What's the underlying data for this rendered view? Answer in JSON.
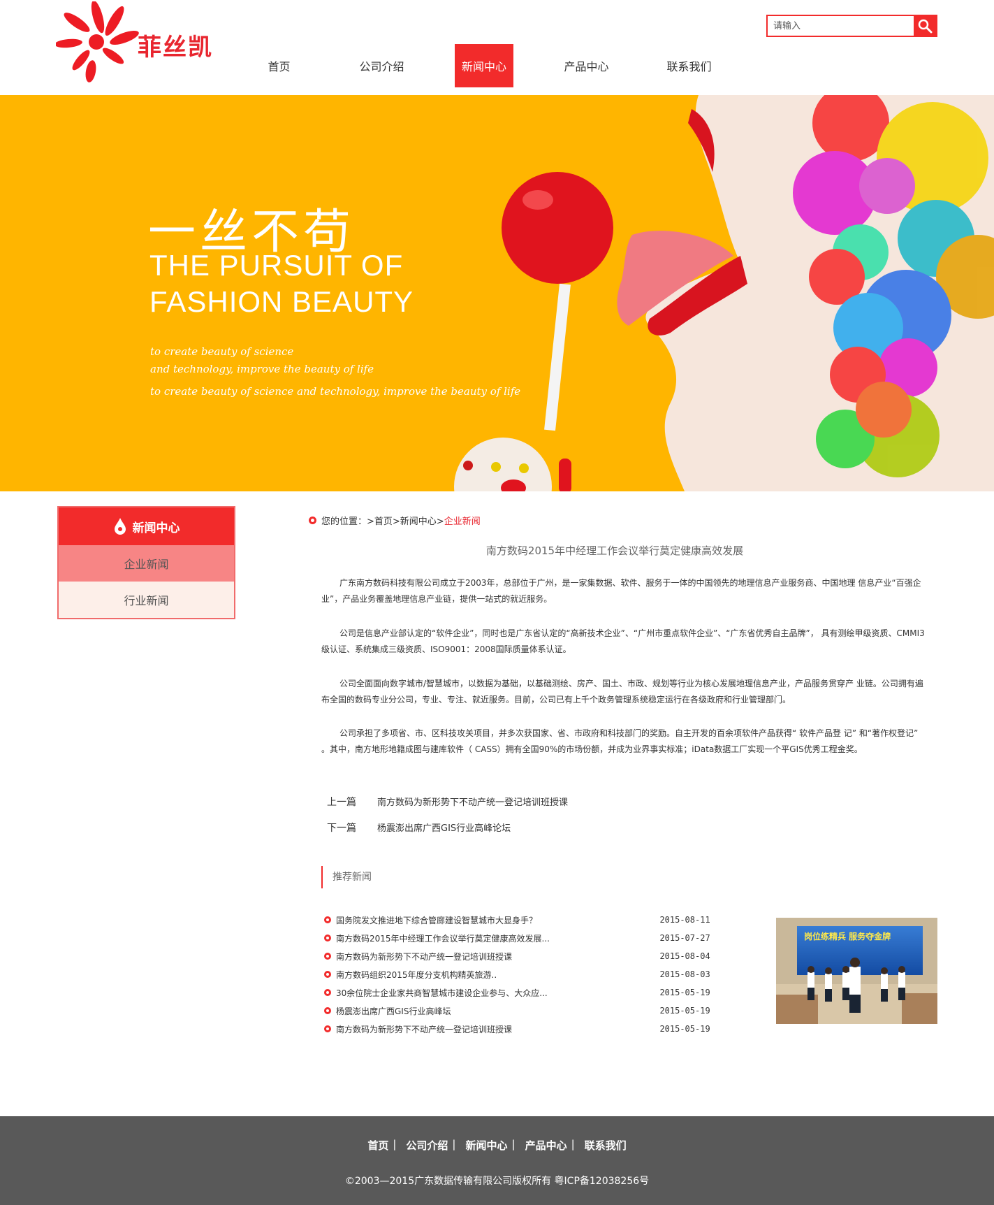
{
  "brand": {
    "logo_text": "菲丝凯",
    "accent": "#f22b2b"
  },
  "search": {
    "placeholder": "请输入"
  },
  "nav": [
    {
      "label": "首页"
    },
    {
      "label": "公司介绍"
    },
    {
      "label": "新闻中心",
      "active": true
    },
    {
      "label": "产品中心"
    },
    {
      "label": "联系我们"
    }
  ],
  "banner": {
    "headline_cn": "一丝不苟",
    "headline_en_1": "THE PURSUIT OF",
    "headline_en_2": "FASHION BEAUTY",
    "sub_1": "to create beauty of science",
    "sub_2": "and technology, improve the beauty of life",
    "sub_3": "to create beauty of science and technology, improve the beauty of life",
    "bg_color": "#ffb500"
  },
  "sidebar": {
    "title": "新闻中心",
    "items": [
      {
        "label": "企业新闻",
        "active": true
      },
      {
        "label": "行业新闻"
      }
    ]
  },
  "breadcrumb": {
    "prefix": "您的位置：",
    "path": ">首页>新闻中心>",
    "current": "企业新闻"
  },
  "article": {
    "title": "南方数码2015年中经理工作会议举行莫定健康高效发展",
    "paragraphs": [
      "广东南方数码科技有限公司成立于2003年，总部位于广州，是一家集数据、软件、服务于一体的中国领先的地理信息产业服务商、中国地理 信息产业“百强企业”，产品业务覆盖地理信息产业链，提供一站式的就近服务。",
      "公司是信息产业部认定的“软件企业”，同时也是广东省认定的“高新技术企业”、“广州市重点软件企业”、“广东省优秀自主品牌”， 具有测绘甲级资质、CMMI3级认证、系统集成三级资质、ISO9001：2008国际质量体系认证。",
      "公司全面面向数字城市/智慧城市，以数据为基础，以基础测绘、房产、国土、市政、规划等行业为核心发展地理信息产业，产品服务贯穿产 业链。公司拥有遍布全国的数码专业分公司，专业、专注、就近服务。目前，公司已有上千个政务管理系统稳定运行在各级政府和行业管理部门。",
      "公司承担了多项省、市、区科技攻关项目，并多次获国家、省、市政府和科技部门的奖励。自主开发的百余项软件产品获得“ 软件产品登 记” 和“著作权登记” 。其中，南方地形地籍成图与建库软件（ CASS）拥有全国90%的市场份额，并成为业界事实标准；iData数据工厂实现一个平GIS优秀工程金奖。"
    ],
    "prev_label": "上一篇",
    "prev_title": "南方数码为新形势下不动产统一登记培训班授课",
    "next_label": "下一篇",
    "next_title": "杨震澎出席广西GIS行业高峰论坛"
  },
  "recommended": {
    "title": "推荐新闻",
    "items": [
      {
        "title": "国务院发文推进地下综合管廊建设智慧城市大显身手？",
        "date": "2015-08-11"
      },
      {
        "title": "南方数码2015年中经理工作会议举行莫定健康高效发展...",
        "date": "2015-07-27"
      },
      {
        "title": "南方数码为新形势下不动产统一登记培训班授课",
        "date": "2015-08-04"
      },
      {
        "title": "南方数码组织2015年度分支机构精英旅游..",
        "date": "2015-08-03"
      },
      {
        "title": "30余位院士企业家共商智慧城市建设企业参与、大众应...",
        "date": "2015-05-19"
      },
      {
        "title": "杨震澎出席广西GIS行业高峰坛",
        "date": "2015-05-19"
      },
      {
        "title": "南方数码为新形势下不动产统一登记培训班授课",
        "date": "2015-05-19"
      }
    ],
    "photo_banner_text": "岗位练精兵 服务夺金牌"
  },
  "footer": {
    "links": [
      "首页",
      "公司介绍",
      "新闻中心",
      "产品中心",
      "联系我们"
    ],
    "separator": "|",
    "copyright": "©2003—2015广东数据传输有限公司版权所有  粤ICP备12038256号",
    "bg_color": "#595959"
  }
}
